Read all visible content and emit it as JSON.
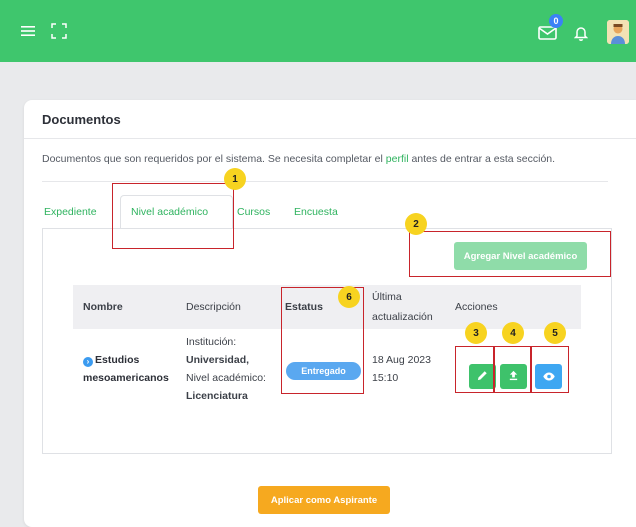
{
  "topbar": {
    "color": "#3fc66d",
    "icons": [
      "menu-icon",
      "expand-icon",
      "mail-icon",
      "bell-icon",
      "avatar"
    ],
    "mail_badge": "0"
  },
  "card": {
    "title": "Documentos",
    "description_pre": "Documentos que son requeridos por el sistema. Se necesita completar el ",
    "description_link": "perfil",
    "description_post": " antes de entrar a esta sección."
  },
  "tabs": [
    {
      "label": "Expediente"
    },
    {
      "label": "Nivel académico",
      "active": true
    },
    {
      "label": "Cursos"
    },
    {
      "label": "Encuesta"
    }
  ],
  "add_button": "Agregar Nivel académico",
  "table": {
    "headers": {
      "name": "Nombre",
      "description": "Descripción",
      "status": "Estatus",
      "updated_line1": "Última",
      "updated_line2": "actualización",
      "actions": "Acciones"
    },
    "row": {
      "name_line1": "Estudios",
      "name_line2": "mesoamericanos",
      "desc_label1": "Institución:",
      "desc_value1": "Universidad,",
      "desc_label2": "Nivel académico:",
      "desc_value2": "Licenciatura",
      "status": "Entregado",
      "date": "18 Aug 2023",
      "time": "15:10"
    },
    "action_icons": [
      "edit-icon",
      "upload-icon",
      "view-icon"
    ]
  },
  "apply_button": "Aplicar como Aspirante",
  "annotations": [
    "1",
    "2",
    "3",
    "4",
    "5",
    "6"
  ],
  "colors": {
    "accent": "#3fc66d",
    "link": "#2fb35f",
    "add_button": "#8fdca9",
    "badge": "#5aa8f0",
    "apply": "#f6a91f",
    "annotation_box": "#c8242b",
    "annotation_marker": "#f7d320"
  }
}
